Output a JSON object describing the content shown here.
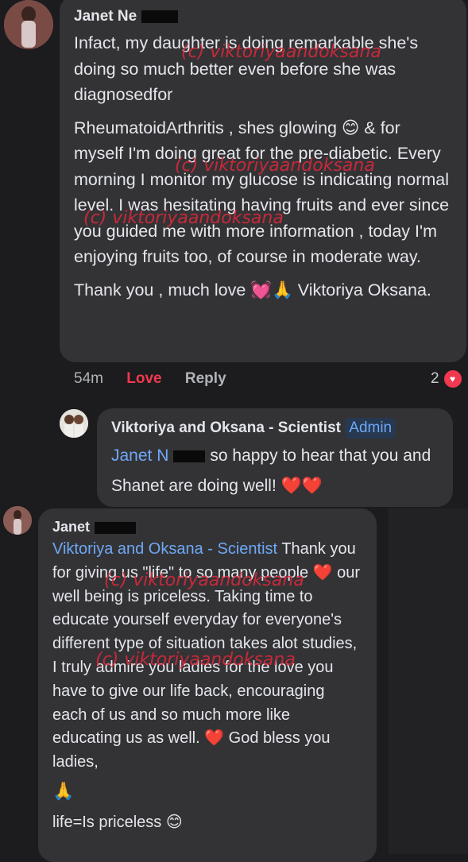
{
  "comment1": {
    "author": "Janet Ne",
    "paragraphs": [
      "Infact, my daughter is doing remarkable she's doing so much better even before she was diagnosedfor",
      "RheumatoidArthritis , shes glowing 😊 & for myself I'm doing great for the pre-diabetic. Every morning I monitor my glucose is indicating normal level. I was hesitating having fruits and ever since you guided me with more information , today I'm enjoying fruits too, of course in moderate way.",
      "Thank you , much love 💓🙏 Viktoriya Oksana."
    ],
    "meta": {
      "time": "54m",
      "love": "Love",
      "reply": "Reply",
      "reaction_count": "2"
    }
  },
  "reply1": {
    "author": "Viktoriya and Oksana - Scientist",
    "badge": "Admin",
    "mention": "Janet N",
    "text": "so happy to hear that you and Shanet are doing well! ❤️❤️"
  },
  "comment2": {
    "author": "Janet",
    "mention": "Viktoriya and Oksana - Scientist",
    "text": "Thank you for giving us \"life\" to so many people ❤️ our well being is priceless. Taking time to educate yourself everyday for everyone's different type of situation takes alot studies, I truly admire you ladies for the love you have to give our life back, encouraging each of us and so much more like educating us as well. ❤️  God bless you ladies,",
    "pray": "🙏",
    "last_line": "life=Is priceless 😊"
  },
  "watermark": "(c) viktoriyaandoksana",
  "colors": {
    "background": "#1c1c1e",
    "bubble": "#333336",
    "link": "#6fa8f5",
    "love": "#f0384f",
    "watermark": "#e0283a"
  }
}
